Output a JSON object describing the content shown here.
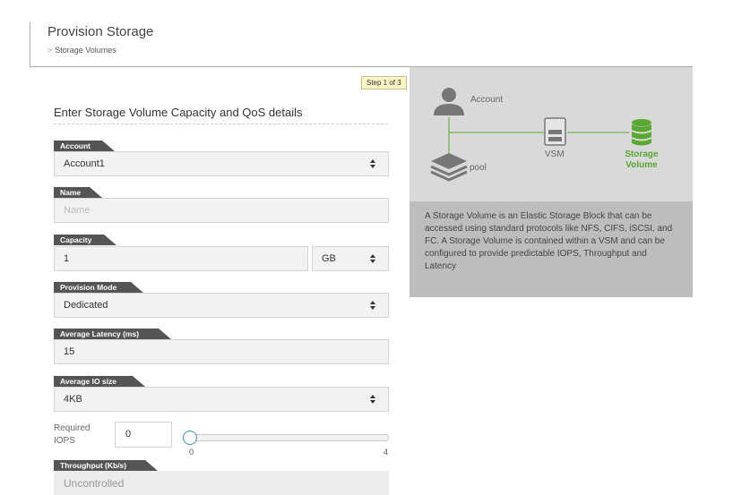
{
  "header": {
    "title": "Provision Storage",
    "breadcrumb_sep": ">",
    "breadcrumb": "Storage Volumes"
  },
  "step": "Step 1 of 3",
  "form": {
    "heading": "Enter Storage Volume Capacity and QoS details",
    "account": {
      "label": "Account",
      "value": "Account1"
    },
    "name": {
      "label": "Name",
      "placeholder": "Name"
    },
    "capacity": {
      "label": "Capacity",
      "value": "1",
      "unit": "GB"
    },
    "provision_mode": {
      "label": "Provision Mode",
      "value": "Dedicated"
    },
    "latency": {
      "label": "Average Latency (ms)",
      "value": "15"
    },
    "io_size": {
      "label": "Average IO size",
      "value": "4KB"
    },
    "iops": {
      "label": "Required IOPS",
      "value": "0",
      "min": "0",
      "max": "4",
      "level": 0
    },
    "throughput": {
      "label": "Throughput (Kb/s)",
      "value": "Uncontrolled"
    }
  },
  "diagram": {
    "account": "Account",
    "pool": "pool",
    "vsm": "VSM",
    "storage": "Storage Volume",
    "colors": {
      "accent_green": "#5aa832",
      "icon_gray": "#777777"
    },
    "icons": [
      "user-icon",
      "layers-icon",
      "server-icon",
      "database-icon"
    ],
    "description": "A Storage Volume is an Elastic Storage Block that can be accessed using standard protocols like NFS, CIFS, iSCSI, and FC. A Storage Volume is contained within a VSM and can be configured to provide predictable IOPS, Throughput and Latency"
  }
}
